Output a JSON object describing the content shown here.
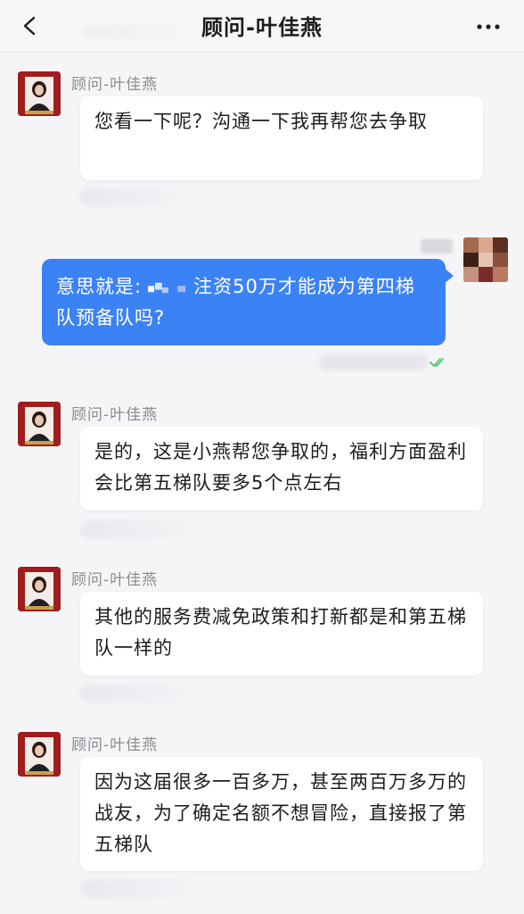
{
  "header": {
    "title": "顾问-叶佳燕",
    "back_icon": "chevron-left-icon",
    "more_icon": "more-dots-icon"
  },
  "messages": [
    {
      "direction": "in",
      "sender": "顾问-叶佳燕",
      "text": "您看一下呢？沟通一下我再帮您去争取"
    },
    {
      "direction": "out",
      "text_before": "意思就是:",
      "text_after": "注资50万才能成为第四梯队预备队吗?",
      "status_icon": "read-check-icon"
    },
    {
      "direction": "in",
      "sender": "顾问-叶佳燕",
      "text": "是的，这是小燕帮您争取的，福利方面盈利会比第五梯队要多5个点左右"
    },
    {
      "direction": "in",
      "sender": "顾问-叶佳燕",
      "text": "其他的服务费减免政策和打新都是和第五梯队一样的"
    },
    {
      "direction": "in",
      "sender": "顾问-叶佳燕",
      "text": "因为这届很多一百多万，甚至两百万多万的战友，为了确定名额不想冒险，直接报了第五梯队"
    }
  ],
  "colors": {
    "outgoing_bubble": "#3b82f5",
    "incoming_bubble": "#ffffff",
    "avatar_bg": "#9e1b1b",
    "read_check": "#34c759"
  }
}
